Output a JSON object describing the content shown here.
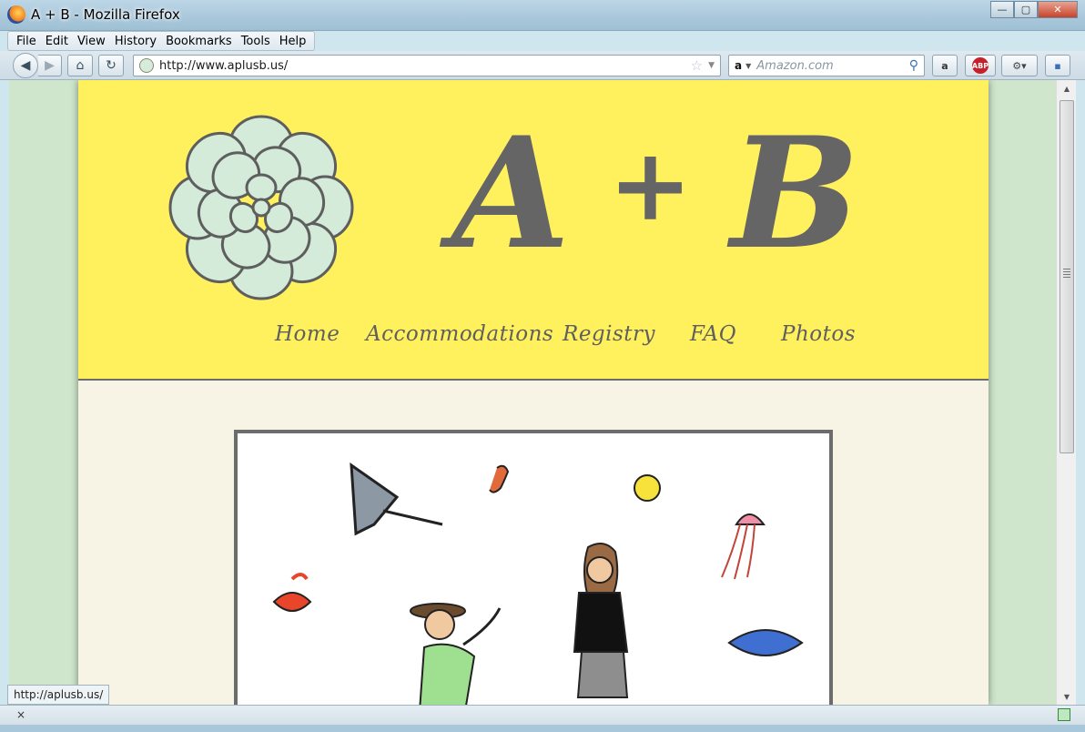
{
  "window": {
    "title": "A + B - Mozilla Firefox",
    "minimize": "—",
    "maximize": "▢",
    "close": "✕"
  },
  "menu": [
    "File",
    "Edit",
    "View",
    "History",
    "Bookmarks",
    "Tools",
    "Help"
  ],
  "toolbar": {
    "back": "◀",
    "forward": "▶",
    "home": "⌂",
    "reload": "↻",
    "url": "http://www.aplusb.us/",
    "star": "☆",
    "url_dropdown": "▼",
    "search_engine": "a",
    "search_dropdown": "▼",
    "search_placeholder": "Amazon.com",
    "search_go": "⚲",
    "amazon_button": "a",
    "adblock": "ABP",
    "tools_button": "⚙▾",
    "sidebar_button": "▪"
  },
  "page": {
    "brand_a": "A",
    "brand_plus": "+",
    "brand_b": "B",
    "nav": [
      "Home",
      "Accommodations",
      "Registry",
      "FAQ",
      "Photos"
    ]
  },
  "status": {
    "hover_url": "http://aplusb.us/",
    "close": "×"
  },
  "colors": {
    "header_bg": "#fff15e",
    "content_bg": "#f7f4e6",
    "side_bg": "#cfe6cc",
    "brand_text": "#656565"
  }
}
